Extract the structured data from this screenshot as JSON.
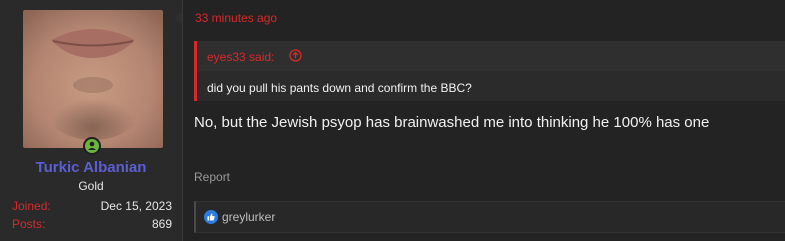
{
  "post": {
    "timestamp": "33 minutes ago",
    "quote": {
      "author_label": "eyes33 said:",
      "text": "did you pull his pants down and confirm the BBC?"
    },
    "message": "No, but the Jewish psyop has brainwashed me into thinking he 100% has one",
    "report_label": "Report",
    "reactions": {
      "icon": "like-icon",
      "users": "greylurker"
    }
  },
  "author": {
    "username": "Turkic Albanian",
    "title": "Gold",
    "joined_label": "Joined:",
    "joined_value": "Dec 15, 2023",
    "posts_label": "Posts:",
    "posts_value": "869",
    "online_status": "online"
  },
  "colors": {
    "accent": "#d62a2a",
    "username": "#5b5fd1",
    "online": "#6db33f",
    "like": "#2d7be0"
  }
}
